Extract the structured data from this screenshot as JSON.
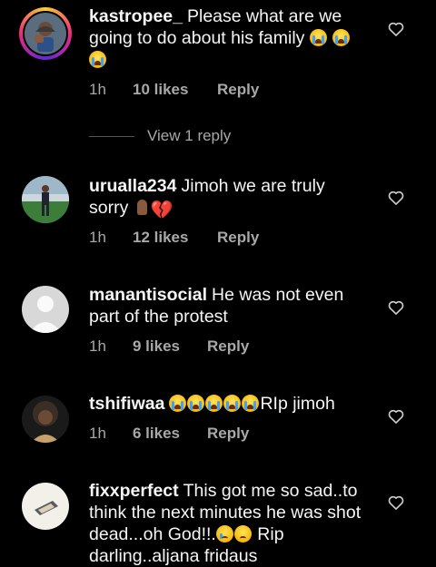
{
  "comments": [
    {
      "username": "kastropee_",
      "text_parts": [
        "Please what are we going to do about his family"
      ],
      "time": "1h",
      "likes": "10 likes",
      "reply": "Reply"
    },
    {
      "username": "urualla234",
      "text_parts": [
        "Jimoh we are truly sorry"
      ],
      "time": "1h",
      "likes": "12 likes",
      "reply": "Reply"
    },
    {
      "username": "manantisocial",
      "text_parts": [
        "He was not even part of the protest"
      ],
      "time": "1h",
      "likes": "9 likes",
      "reply": "Reply"
    },
    {
      "username": "tshifiwaa",
      "text_parts": [
        "RIp jimoh"
      ],
      "time": "1h",
      "likes": "6 likes",
      "reply": "Reply"
    },
    {
      "username": "fixxperfect",
      "text_parts": [
        "This got me so sad..to think the next minutes he was shot dead...oh God!!.",
        "Rip darling..aljana fridaus"
      ]
    }
  ],
  "view_replies": "View 1 reply",
  "icons": {
    "like": "heart-outline-icon",
    "crying": "loudly-crying-face-icon",
    "praying": "folded-hands-icon",
    "broken_heart": "broken-heart-icon",
    "sad_tear": "crying-face-icon",
    "worried": "worried-face-icon"
  },
  "colors": {
    "background": "#000000",
    "text": "#f5f5f5",
    "meta": "#a8a8a8"
  }
}
